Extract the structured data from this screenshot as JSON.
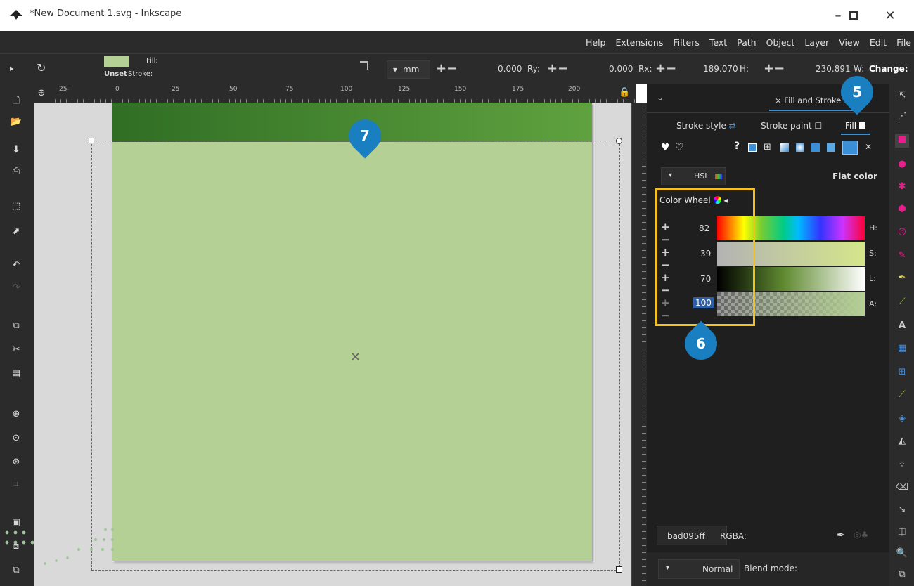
{
  "window": {
    "title": "*New Document 1.svg - Inkscape",
    "minimize": "–",
    "maximize": "☐",
    "close": "✕"
  },
  "menu": [
    "File",
    "Edit",
    "View",
    "Layer",
    "Object",
    "Path",
    "Text",
    "Filters",
    "Extensions",
    "Help"
  ],
  "toolbar": {
    "fill_label": "Fill:",
    "stroke_label": "Stroke:",
    "stroke_value": "Unset",
    "fill_swatch": "#b5d094",
    "unit": "mm",
    "ry_label": "Ry:",
    "ry_value": "0.000",
    "rx_label": "Rx:",
    "rx_value": "0.000",
    "h_label": "H:",
    "h_value": "189.070",
    "w_label": "W:",
    "w_value": "230.891",
    "change_label": "Change:"
  },
  "ruler": {
    "ticks": [
      "25-",
      "0",
      "25",
      "50",
      "75",
      "100",
      "125",
      "150",
      "175",
      "200"
    ]
  },
  "panel": {
    "tab_label": "× Fill and Stroke",
    "subtabs": {
      "stroke_style": "Stroke style",
      "stroke_paint": "Stroke paint",
      "fill": "Fill"
    },
    "mode_label": "Flat color",
    "color_space": "HSL",
    "color_wheel": "Color Wheel",
    "sliders": [
      {
        "label": "H:",
        "value": "82"
      },
      {
        "label": "S:",
        "value": "39"
      },
      {
        "label": "L:",
        "value": "70"
      },
      {
        "label": "A:",
        "value": "100"
      }
    ],
    "hex_value": "bad095ff",
    "rgba_label": "RGBA:",
    "blend_value": "Normal",
    "blend_label": "Blend mode:"
  },
  "badges": {
    "b5": "5",
    "b6": "6",
    "b7": "7"
  },
  "colors": {
    "rect_fill": "#b5d094",
    "rect_top": "#3c8a2e",
    "highlight": "#f5c21b",
    "badge": "#1a7fc1",
    "dark_bg": "#2b2b2b"
  }
}
